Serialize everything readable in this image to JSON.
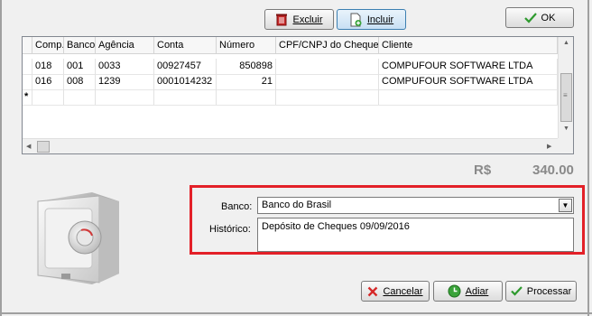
{
  "toolbar": {
    "excluir_label": "Excluir",
    "incluir_label": "Incluir",
    "ok_label": "OK"
  },
  "grid": {
    "columns": [
      "Comp.",
      "Banco",
      "Agência",
      "Conta",
      "Número",
      "CPF/CNPJ do Cheque",
      "Cliente"
    ],
    "rows": [
      {
        "comp": "018",
        "banco": "001",
        "agencia": "0033",
        "conta": "00927457",
        "numero": "850898",
        "cpf": "",
        "cliente": "COMPUFOUR SOFTWARE LTDA"
      },
      {
        "comp": "016",
        "banco": "008",
        "agencia": "1239",
        "conta": "0001014232",
        "numero": "21",
        "cpf": "",
        "cliente": "COMPUFOUR SOFTWARE LTDA"
      }
    ],
    "new_row_marker": "*"
  },
  "total": {
    "currency": "R$",
    "value": "340.00"
  },
  "form": {
    "banco_label": "Banco:",
    "banco_value": "Banco do Brasil",
    "historico_label": "Histórico:",
    "historico_value": "Depósito de Cheques 09/09/2016"
  },
  "footer": {
    "cancelar_label": "Cancelar",
    "adiar_label": "Adiar",
    "processar_label": "Processar"
  },
  "icons": {
    "excluir": "trash-icon",
    "incluir": "add-document-icon",
    "ok": "checkmark-icon",
    "cancelar": "x-icon",
    "adiar": "clock-icon",
    "processar": "checkmark-icon",
    "safe": "safe-icon"
  },
  "colors": {
    "highlight_border": "#e32028",
    "ok_check": "#2e9a2e",
    "cancel_x": "#d62828",
    "total_text": "#8a8a8a"
  }
}
